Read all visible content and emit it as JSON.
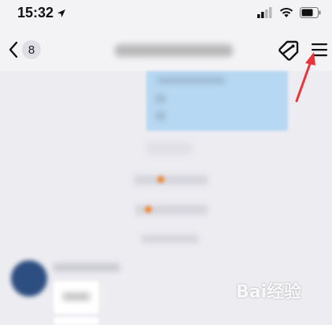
{
  "status_bar": {
    "time": "15:32"
  },
  "nav": {
    "back_count": "8"
  },
  "colors": {
    "annotation_arrow": "#e8353b",
    "message_bubble": "#b7d8f2",
    "background": "#ececf1"
  },
  "icons": [
    "location-arrow-icon",
    "signal-icon",
    "wifi-icon",
    "battery-icon",
    "chevron-left-icon",
    "tag-icon",
    "menu-icon"
  ],
  "watermark": "Bai经验"
}
